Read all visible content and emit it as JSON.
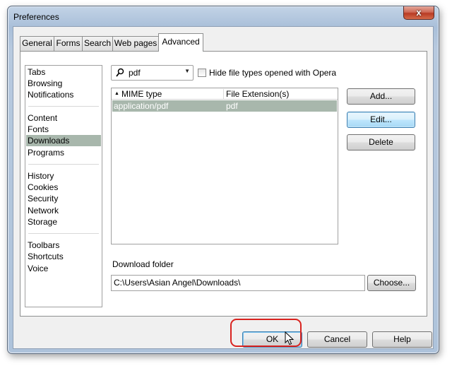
{
  "window": {
    "title": "Preferences",
    "close_glyph": "x"
  },
  "tabs": [
    "General",
    "Forms",
    "Search",
    "Web pages",
    "Advanced"
  ],
  "active_tab": "Advanced",
  "categories": [
    [
      "Tabs",
      "Browsing",
      "Notifications"
    ],
    [
      "Content",
      "Fonts",
      "Downloads",
      "Programs"
    ],
    [
      "History",
      "Cookies",
      "Security",
      "Network",
      "Storage"
    ],
    [
      "Toolbars",
      "Shortcuts",
      "Voice"
    ]
  ],
  "selected_category": "Downloads",
  "filter": {
    "value": "pdf",
    "icon": "search-icon"
  },
  "hide_checkbox": {
    "label": "Hide file types opened with Opera",
    "checked": false
  },
  "table": {
    "columns": [
      "MIME type",
      "File Extension(s)"
    ],
    "rows": [
      [
        "application/pdf",
        "pdf"
      ]
    ]
  },
  "side_buttons": {
    "add": "Add...",
    "edit": "Edit...",
    "delete": "Delete"
  },
  "download": {
    "label": "Download folder",
    "path": "C:\\Users\\Asian Angel\\Downloads\\",
    "choose": "Choose..."
  },
  "footer": {
    "ok": "OK",
    "cancel": "Cancel",
    "help": "Help"
  },
  "colors": {
    "selection": "#a8b7ac",
    "annotation": "#d9231f"
  }
}
